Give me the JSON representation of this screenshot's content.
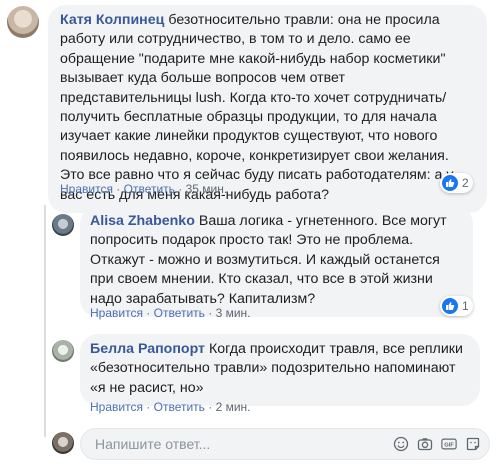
{
  "comment": {
    "author": "Катя Колпинец",
    "text": "безотносительно травли: она не просила работу или сотрудничество, в том то и дело. само ее обращение \"подарите мне какой-нибудь набор косметики\" вызывает куда больше вопросов чем ответ представительницы lush. Когда кто-то хочет сотрудничать/получить бесплатные образцы продукции, то для начала изучает какие линейки продуктов существуют, что нового появилось недавно, короче, конкретизирует свои желания. Это все равно что я сейчас буду писать работодателям: а у вас есть для меня какая-нибудь работа?",
    "like_label": "Нравится",
    "reply_label": "Ответить",
    "time": "35 мин.",
    "reactions": "2"
  },
  "replies": [
    {
      "author": "Alisa Zhabenko",
      "text": "Ваша логика - угнетенного. Все могут попросить подарок просто так! Это не проблема. Откажут - можно и возмутиться. И каждый останется при своем мнении. Кто сказал, что все в этой жизни надо зарабатывать? Капитализм?",
      "like_label": "Нравится",
      "reply_label": "Ответить",
      "time": "3 мин.",
      "reactions": "1"
    },
    {
      "author": "Белла Рапопорт",
      "text": "Когда происходит травля, все реплики «безотносительно травли» подозрительно напоминают «я не расист, но»",
      "like_label": "Нравится",
      "reply_label": "Ответить",
      "time": "2 мин."
    }
  ],
  "separator": " · ",
  "compose": {
    "placeholder": "Напишите ответ...",
    "gif_label": "GIF"
  },
  "colors": {
    "link": "#385898",
    "bubble": "#f2f3f5",
    "like_blue": "#1877f2"
  }
}
